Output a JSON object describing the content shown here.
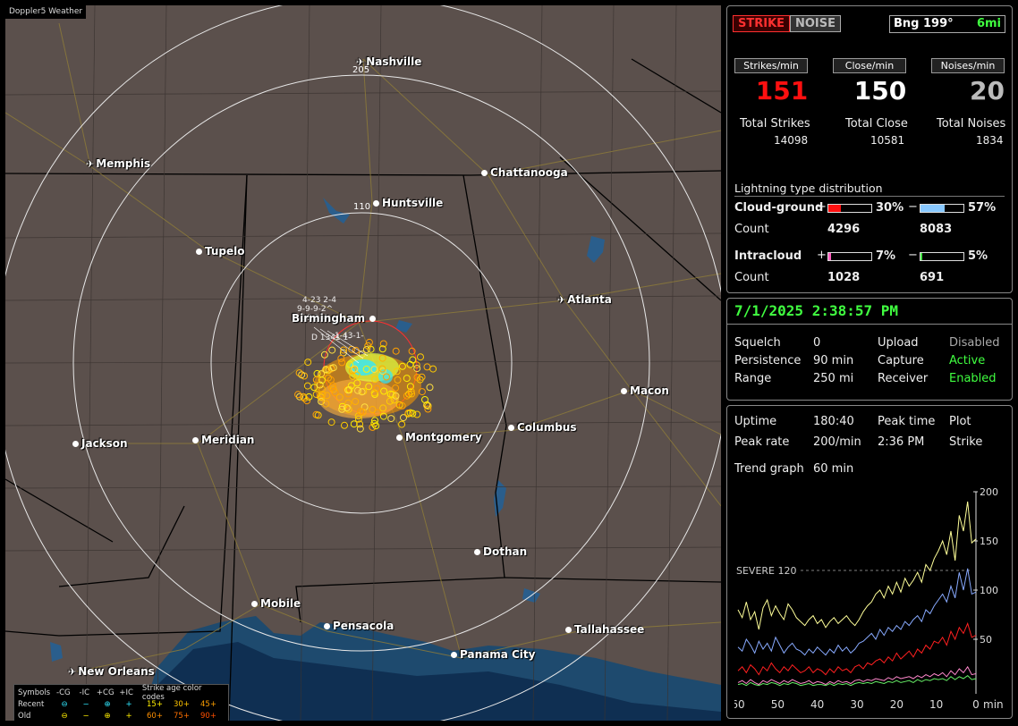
{
  "map": {
    "title": "Doppler5 Weather",
    "cities": [
      {
        "name": "Nashville",
        "kind": "airport"
      },
      {
        "name": "Memphis",
        "kind": "airport"
      },
      {
        "name": "Chattanooga",
        "kind": "city"
      },
      {
        "name": "Huntsville",
        "kind": "city"
      },
      {
        "name": "Tupelo",
        "kind": "city"
      },
      {
        "name": "Atlanta",
        "kind": "airport"
      },
      {
        "name": "Birmingham",
        "kind": "city"
      },
      {
        "name": "Macon",
        "kind": "city"
      },
      {
        "name": "Jackson",
        "kind": "city"
      },
      {
        "name": "Meridian",
        "kind": "city"
      },
      {
        "name": "Montgomery",
        "kind": "city"
      },
      {
        "name": "Columbus",
        "kind": "city"
      },
      {
        "name": "Dothan",
        "kind": "city"
      },
      {
        "name": "Mobile",
        "kind": "city"
      },
      {
        "name": "Pensacola",
        "kind": "city"
      },
      {
        "name": "Tallahassee",
        "kind": "city"
      },
      {
        "name": "Panama City",
        "kind": "city"
      },
      {
        "name": "New Orleans",
        "kind": "airport"
      }
    ],
    "ring_labels": [
      "205",
      "110"
    ],
    "colors": {
      "land": "#5b504c",
      "water": "#1e4a6e",
      "ring": "#e8e8e8",
      "state_line": "#000000",
      "road": "#8c7a3a"
    }
  },
  "legend": {
    "header": [
      "Symbols",
      "-CG",
      "-IC",
      "+CG",
      "+IC",
      "Strike age color codes"
    ],
    "recent": {
      "label": "Recent",
      "ages": [
        "15+",
        "30+",
        "45+"
      ]
    },
    "old": {
      "label": "Old",
      "ages": [
        "60+",
        "75+",
        "90+"
      ]
    }
  },
  "status": {
    "strike_tag": "STRIKE",
    "noise_tag": "NOISE",
    "bearing_label": "Bng 199°",
    "bearing_distance": "6mi",
    "rate_headers": [
      "Strikes/min",
      "Close/min",
      "Noises/min"
    ],
    "rates": [
      "151",
      "150",
      "20"
    ],
    "totals_labels": [
      "Total Strikes",
      "Total Close",
      "Total Noises"
    ],
    "totals": [
      "14098",
      "10581",
      "1834"
    ],
    "distribution_title": "Lightning type distribution",
    "cloud_ground_label": "Cloud-ground",
    "intracloud_label": "Intracloud",
    "count_label": "Count",
    "plus_sign": "+",
    "minus_sign": "−",
    "cg_pos_pct": "30%",
    "cg_neg_pct": "57%",
    "cg_pos_count": "4296",
    "cg_neg_count": "8083",
    "ic_pos_pct": "7%",
    "ic_neg_pct": "5%",
    "ic_pos_count": "1028",
    "ic_neg_count": "691",
    "fractions": {
      "cg_pos": 0.3,
      "cg_neg": 0.57,
      "ic_pos": 0.07,
      "ic_neg": 0.05
    }
  },
  "settings": {
    "datetime": "7/1/2025 2:38:57 PM",
    "rows": [
      {
        "k1": "Squelch",
        "v1": "0",
        "k2": "Upload",
        "v2": "Disabled"
      },
      {
        "k1": "Persistence",
        "v1": "90 min",
        "k2": "Capture",
        "v2": "Active"
      },
      {
        "k1": "Range",
        "v1": "250 mi",
        "k2": "Receiver",
        "v2": "Enabled"
      }
    ]
  },
  "stats": {
    "uptime_label": "Uptime",
    "uptime": "180:40",
    "peak_time_label": "Peak time",
    "peak_time": "2:36 PM",
    "plot_label": "Plot",
    "plot": "Strike",
    "peak_rate_label": "Peak rate",
    "peak_rate": "200/min",
    "trend_label": "Trend graph",
    "trend_window": "60 min"
  },
  "chart_data": {
    "type": "line",
    "x_label": "min",
    "x_ticks": [
      "60",
      "50",
      "40",
      "30",
      "20",
      "10",
      "0"
    ],
    "y_ticks": [
      "200",
      "150",
      "100",
      "50"
    ],
    "ylim": [
      0,
      200
    ],
    "threshold": {
      "label": "SEVERE 120",
      "value": 120
    },
    "series": [
      {
        "color": "#ffff99",
        "values": [
          80,
          72,
          88,
          70,
          78,
          60,
          82,
          90,
          74,
          84,
          76,
          70,
          86,
          80,
          72,
          68,
          64,
          70,
          74,
          66,
          70,
          62,
          68,
          72,
          66,
          70,
          74,
          68,
          64,
          70,
          78,
          84,
          88,
          96,
          100,
          92,
          104,
          96,
          108,
          98,
          112,
          104,
          110,
          118,
          108,
          126,
          120,
          132,
          140,
          150,
          136,
          160,
          130,
          176,
          160,
          190,
          148,
          152
        ]
      },
      {
        "color": "#88aaff",
        "values": [
          42,
          38,
          50,
          44,
          36,
          48,
          40,
          46,
          38,
          52,
          44,
          36,
          42,
          46,
          40,
          38,
          34,
          40,
          36,
          42,
          38,
          34,
          40,
          36,
          44,
          38,
          42,
          36,
          40,
          46,
          48,
          52,
          56,
          50,
          60,
          54,
          62,
          58,
          64,
          60,
          68,
          64,
          70,
          74,
          68,
          80,
          76,
          84,
          90,
          96,
          88,
          104,
          92,
          118,
          100,
          122,
          96,
          98
        ]
      },
      {
        "color": "#ff2020",
        "values": [
          18,
          22,
          16,
          24,
          20,
          14,
          22,
          18,
          26,
          20,
          16,
          22,
          18,
          24,
          20,
          16,
          18,
          22,
          16,
          20,
          18,
          14,
          20,
          16,
          22,
          18,
          20,
          16,
          22,
          24,
          20,
          26,
          24,
          28,
          30,
          26,
          32,
          28,
          36,
          30,
          34,
          38,
          32,
          40,
          36,
          44,
          40,
          48,
          46,
          52,
          44,
          58,
          50,
          62,
          56,
          66,
          52,
          54
        ]
      },
      {
        "color": "#ff88cc",
        "values": [
          6,
          8,
          5,
          9,
          6,
          4,
          8,
          6,
          9,
          7,
          5,
          8,
          6,
          9,
          7,
          5,
          6,
          8,
          5,
          7,
          6,
          4,
          7,
          5,
          8,
          6,
          7,
          5,
          8,
          9,
          7,
          9,
          8,
          10,
          9,
          8,
          11,
          9,
          12,
          10,
          11,
          12,
          10,
          13,
          11,
          14,
          12,
          15,
          13,
          16,
          12,
          18,
          14,
          20,
          16,
          22,
          14,
          15
        ]
      },
      {
        "color": "#66ee66",
        "values": [
          4,
          5,
          3,
          6,
          4,
          3,
          5,
          4,
          6,
          5,
          3,
          5,
          4,
          6,
          5,
          3,
          4,
          5,
          3,
          4,
          4,
          3,
          5,
          3,
          5,
          4,
          5,
          3,
          5,
          6,
          5,
          6,
          5,
          7,
          6,
          5,
          7,
          6,
          8,
          6,
          7,
          8,
          6,
          9,
          7,
          9,
          8,
          10,
          9,
          10,
          8,
          12,
          9,
          12,
          10,
          13,
          9,
          10
        ]
      }
    ]
  }
}
